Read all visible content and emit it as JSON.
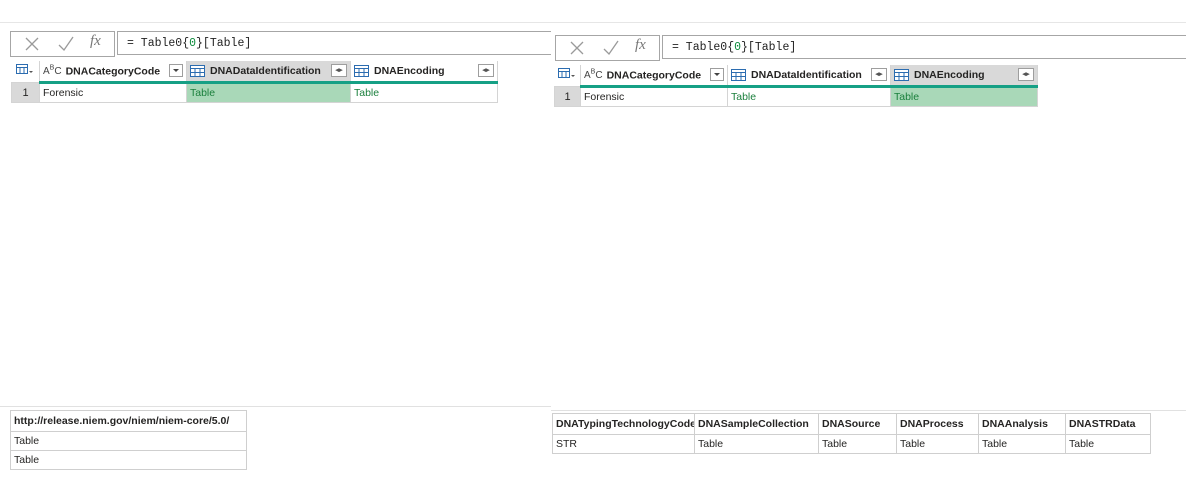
{
  "left": {
    "formula": "= Table0{0}[Table]",
    "columns": [
      {
        "label": "DNACategoryCode",
        "type": "ABC"
      },
      {
        "label": "DNADataIdentification",
        "type": "table"
      },
      {
        "label": "DNAEncoding",
        "type": "table"
      }
    ],
    "rows": [
      {
        "num": "1",
        "cells": [
          "Forensic",
          "Table",
          "Table"
        ]
      }
    ],
    "bottom": {
      "header": "http://release.niem.gov/niem/niem-core/5.0/",
      "rows": [
        "Table",
        "Table"
      ]
    }
  },
  "right": {
    "formula": "= Table0{0}[Table]",
    "columns": [
      {
        "label": "DNACategoryCode",
        "type": "ABC"
      },
      {
        "label": "DNADataIdentification",
        "type": "table"
      },
      {
        "label": "DNAEncoding",
        "type": "table"
      }
    ],
    "rows": [
      {
        "num": "1",
        "cells": [
          "Forensic",
          "Table",
          "Table"
        ]
      }
    ],
    "bottom": {
      "headers": [
        "DNATypingTechnologyCode",
        "DNASampleCollection",
        "DNASource",
        "DNAProcess",
        "DNAAnalysis",
        "DNASTRData"
      ],
      "row": [
        "STR",
        "Table",
        "Table",
        "Table",
        "Table",
        "Table"
      ]
    }
  },
  "colors": {
    "accent": "#16a085",
    "selected_cell": "#a9d8b8",
    "table_link": "#1a7f3c"
  }
}
